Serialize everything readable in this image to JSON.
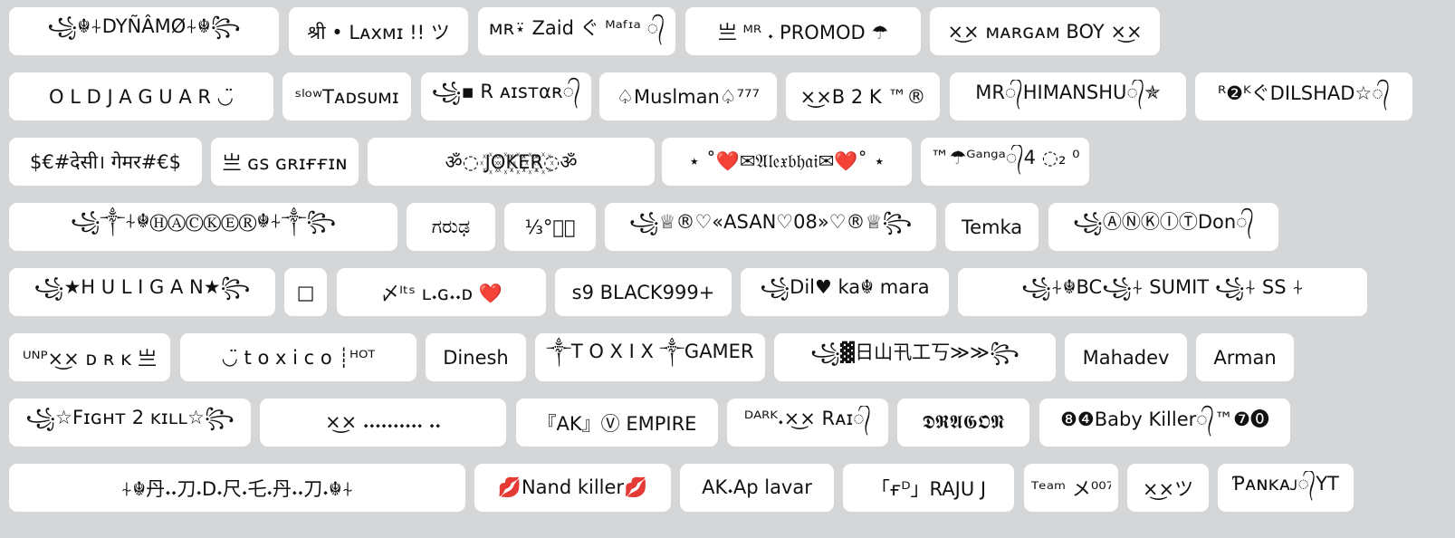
{
  "background_color": "#d5d6d7",
  "chip_color": "#ffffff",
  "rows": [
    [
      "꧁☬⍭DYÑÂMØ⍭☬꧂",
      "श्री • Lᴀxᴍɪ !! ツ",
      "ᴍʀ⍣ Zaid ぐ ᴹᵃᶠᶦᵃ ᭄",
      "亗 ᴹᴿ 𝆺 PROMOD ☂",
      "×͜× ᴍᴀʀɢᴀᴍ BOY ×͜×"
    ],
    [
      "O L D J A G U A R ◡̈",
      "ˢˡᵒʷTᴀᴅsᴜᴍɪ",
      "꧁▪ R ᴀɪsᴛαʀ᭄",
      "♤Muslman♤⁷⁷⁷",
      "×͜×B 2 K ™®",
      "MR᭄HIMANSHU᭄✯",
      "ᴿ❷ᴷぐDILSHAD☆᭄"
    ],
    [
      "$€#देसी। गेमर#€$",
      "亗 ɢs ɢʀɪғғɪɴ",
      "ॐ◌ J꙰O꙰K꙰E꙰R꙰◌ॐ",
      "⋆ ˚❤️✉𝔄𝔩𝔢𝔵𝔟𝔥𝔞𝔦✉❤️˚ ⋆",
      "™☂ᴳᵃⁿᵍᵃ᭄4 ◌₂ ⁰"
    ],
    [
      "꧁༒⍭☬ⒽⒶⒸⓀⒺⓇ☬⍭༒꧂",
      "ಗರುಢ",
      "⅓°𝆺᭄",
      "꧁♕®♡«ASAN♡08»♡®♕꧂",
      "Temka",
      "꧁ⒶⓃⓀⒾⓉDon᭄"
    ],
    [
      "꧁★H U L I G A N★꧂",
      "□",
      "〆ᴵᵗˢ ʟ𝆺ɢ𝆺𝆺ᴅ ❤️",
      "s9 BLACK999+",
      "꧁Dil♥ ka☬ mara",
      "꧁⍭☬BC꧁⍭ SUMIT ꧁⍭ SS ⍭"
    ],
    [
      "ᵁᴺᴾ×͜× ᴅ ʀ ᴋ 亗",
      "◡̈ t o x i c o ┊ᴴᴼᵀ",
      "Dinesh",
      "༒T O X I X ༒GAMER",
      "꧁▓日山卂工丂≫≫꧂",
      "Mahadev",
      "Arman"
    ],
    [
      "꧁☆Fɪɢʜᴛ 2 ᴋɪʟʟ☆꧂",
      "×͜× 𝆺𝆺𝆺𝆺𝆺𝆺𝆺𝆺𝆺𝆺 𝆺𝆺",
      "『AK』Ⓥ EMPIRE",
      "ᴰᴬᴿᴷ𝆺×͜× Rᴀɪ᭄",
      "𝕯𝕽𝕬𝕲𝕺𝕹",
      "❽❹Baby Killer᭄™❼⓿"
    ],
    [
      "⍭☬丹𝆺𝆺刀𝆺D𝆺尺𝆺乇𝆺丹𝆺𝆺刀𝆺☬⍭",
      "💋Nand killer💋",
      "AK𝆺Ap lavar",
      "「ғᴰ」RAJU J",
      "ᵀᵉᵃᵐ メ⁰⁰⁷",
      "×͜×ツ",
      "Ƥᴀɴᴋᴀᴊ᭄YT"
    ]
  ]
}
